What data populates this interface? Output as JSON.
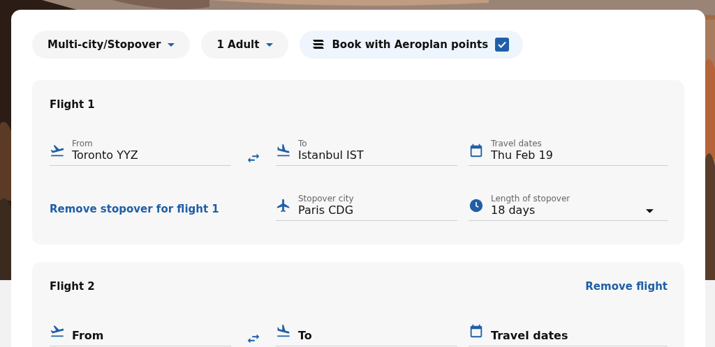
{
  "trip_type": {
    "label": "Multi-city/Stopover"
  },
  "passengers": {
    "label": "1 Adult"
  },
  "points": {
    "label": "Book with Aeroplan points",
    "checked": true
  },
  "flights": [
    {
      "title": "Flight 1",
      "from": {
        "label": "From",
        "value": "Toronto YYZ"
      },
      "to": {
        "label": "To",
        "value": "Istanbul IST"
      },
      "dates": {
        "label": "Travel dates",
        "value": "Thu Feb 19"
      },
      "stopover": {
        "remove_link": "Remove stopover for flight 1",
        "city": {
          "label": "Stopover city",
          "value": "Paris CDG"
        },
        "length": {
          "label": "Length of stopover",
          "value": "18 days"
        }
      }
    },
    {
      "title": "Flight 2",
      "action": "Remove flight",
      "from": {
        "placeholder": "From"
      },
      "to": {
        "placeholder": "To"
      },
      "dates": {
        "placeholder": "Travel dates"
      }
    }
  ]
}
